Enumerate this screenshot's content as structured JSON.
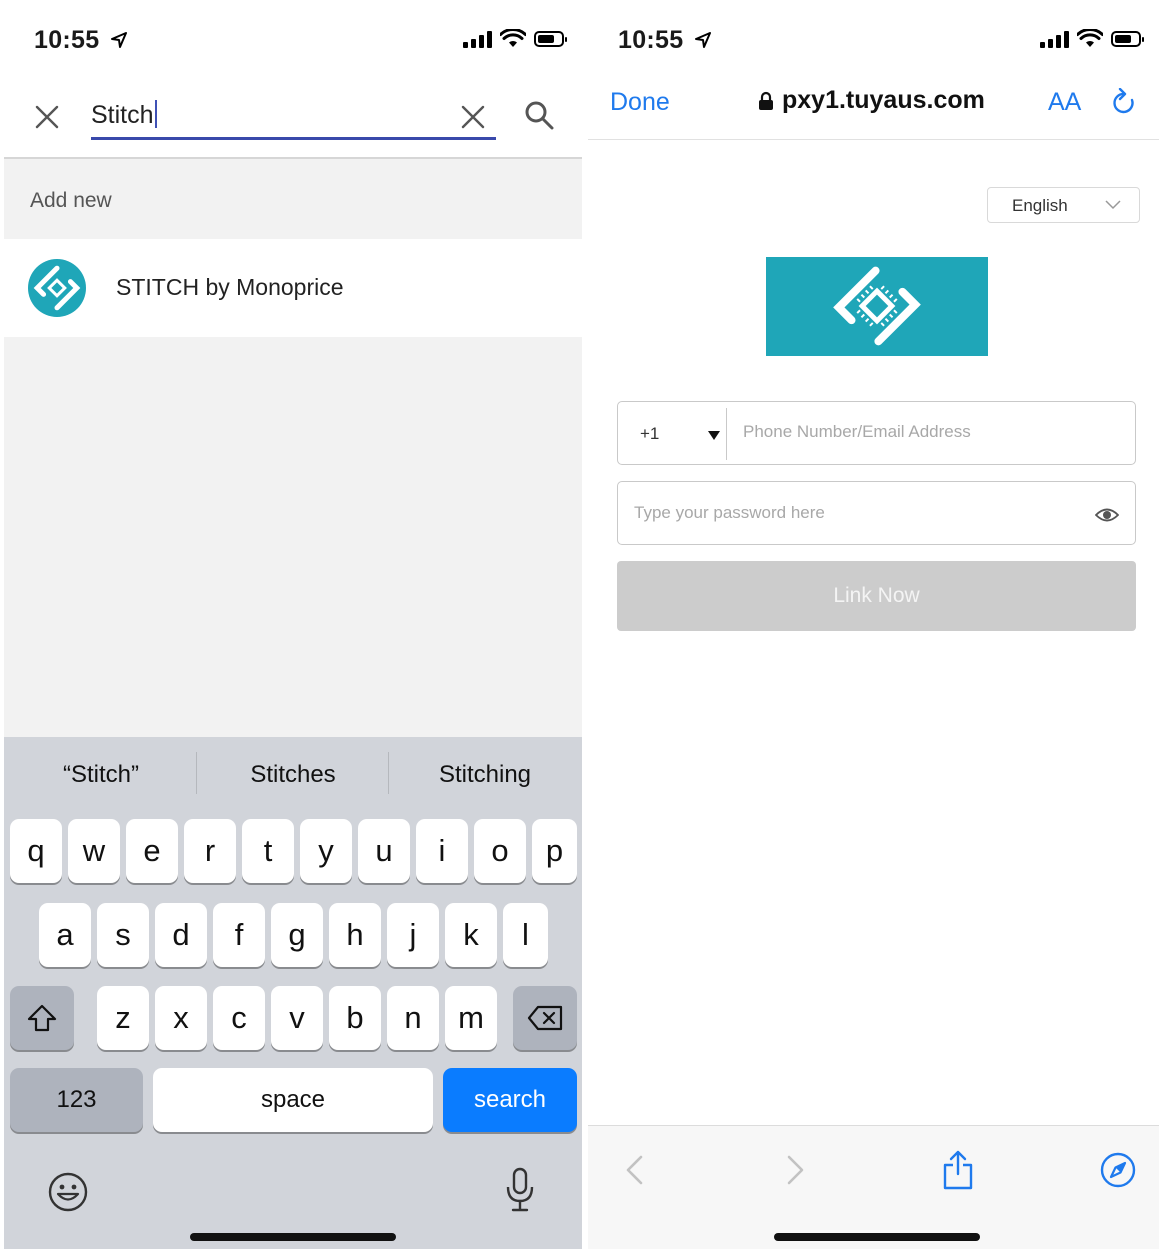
{
  "left": {
    "status": {
      "time": "10:55"
    },
    "search": {
      "value": "Stitch"
    },
    "section_header": "Add new",
    "results": [
      {
        "label": "STITCH by Monoprice"
      }
    ],
    "keyboard": {
      "suggestions": [
        "“Stitch”",
        "Stitches",
        "Stitching"
      ],
      "row1": [
        "q",
        "w",
        "e",
        "r",
        "t",
        "y",
        "u",
        "i",
        "o",
        "p"
      ],
      "row2": [
        "a",
        "s",
        "d",
        "f",
        "g",
        "h",
        "j",
        "k",
        "l"
      ],
      "row3": [
        "z",
        "x",
        "c",
        "v",
        "b",
        "n",
        "m"
      ],
      "numbers_key": "123",
      "space_key": "space",
      "return_key": "search"
    }
  },
  "right": {
    "status": {
      "time": "10:55"
    },
    "nav": {
      "done_label": "Done",
      "url": "pxy1.tuyaus.com",
      "text_size_label": "AA"
    },
    "language": "English",
    "phone": {
      "country_code": "+1",
      "placeholder": "Phone Number/Email Address"
    },
    "password": {
      "placeholder": "Type your password here"
    },
    "submit_label": "Link Now"
  },
  "colors": {
    "accent_blue": "#1f7aed",
    "brand_teal": "#1fa6b8",
    "search_underline": "#3949ab",
    "keyboard_bg": "#d1d4da",
    "return_key": "#0a7cff",
    "disabled_button": "#cccccc"
  }
}
